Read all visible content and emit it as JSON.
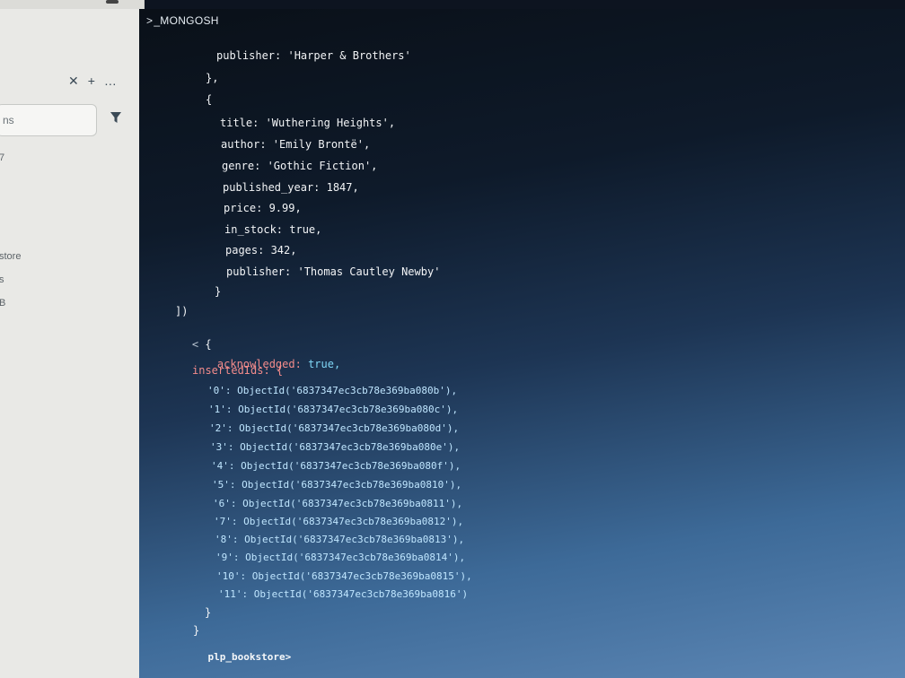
{
  "sidebar": {
    "actions": [
      "✕",
      "+",
      "…"
    ],
    "filter_placeholder": "ns",
    "labels": [
      "7",
      "store",
      "s",
      "B"
    ]
  },
  "terminal": {
    "title": "_MONGOSH",
    "lines": [
      "publisher: 'Harper & Brothers'",
      "},",
      "{",
      "title: 'Wuthering Heights',",
      "author: 'Emily Brontë',",
      "genre: 'Gothic Fiction',",
      "published_year: 1847,",
      "price: 9.99,",
      "in_stock: true,",
      "pages: 342,",
      "publisher: 'Thomas Cautley Newby'",
      "}",
      "])",
      "{"
    ],
    "result": {
      "acknowledged_key": "acknowledged:",
      "acknowledged_val": "true,",
      "inserted_key": "insertedIds: {",
      "ids": [
        "'0': ObjectId('6837347ec3cb78e369ba080b'),",
        "'1': ObjectId('6837347ec3cb78e369ba080c'),",
        "'2': ObjectId('6837347ec3cb78e369ba080d'),",
        "'3': ObjectId('6837347ec3cb78e369ba080e'),",
        "'4': ObjectId('6837347ec3cb78e369ba080f'),",
        "'5': ObjectId('6837347ec3cb78e369ba0810'),",
        "'6': ObjectId('6837347ec3cb78e369ba0811'),",
        "'7': ObjectId('6837347ec3cb78e369ba0812'),",
        "'8': ObjectId('6837347ec3cb78e369ba0813'),",
        "'9': ObjectId('6837347ec3cb78e369ba0814'),",
        "'10': ObjectId('6837347ec3cb78e369ba0815'),",
        "'11': ObjectId('6837347ec3cb78e369ba0816')"
      ],
      "close_inner": "}",
      "close_outer": "}"
    },
    "prompt": "plp_bookstore"
  }
}
